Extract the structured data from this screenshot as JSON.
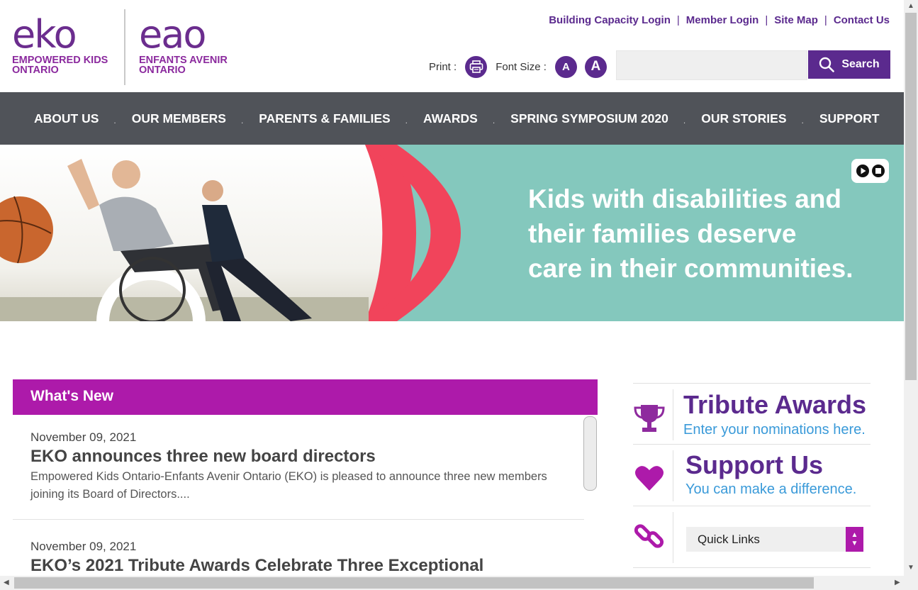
{
  "logos": {
    "eko": {
      "word": "eko",
      "line1": "EMPOWERED KIDS",
      "line2": "ONTARIO"
    },
    "eao": {
      "word": "eao",
      "line1": "ENFANTS AVENIR",
      "line2": "ONTARIO"
    }
  },
  "top_links": {
    "building_capacity": "Building Capacity Login",
    "member_login": "Member Login",
    "site_map": "Site Map",
    "contact_us": "Contact Us",
    "separator": "|"
  },
  "tools": {
    "print_label": "Print :",
    "font_size_label": "Font Size :",
    "font_small": "A",
    "font_large": "A"
  },
  "search": {
    "placeholder": "",
    "button_label": "Search"
  },
  "nav": {
    "items": [
      "ABOUT US",
      "OUR MEMBERS",
      "PARENTS & FAMILIES",
      "AWARDS",
      "SPRING SYMPOSIUM 2020",
      "OUR STORIES",
      "SUPPORT"
    ],
    "separator": "."
  },
  "banner": {
    "line1": "Kids with disabilities and",
    "line2": "their families deserve",
    "line3": "care in their communities."
  },
  "whats_new": {
    "heading": "What's New",
    "items": [
      {
        "date": "November 09, 2021",
        "title": "EKO announces three new board directors",
        "excerpt_line1": "Empowered Kids Ontario-Enfants Avenir Ontario (EKO) is pleased to announce three new members",
        "excerpt_line2": "joining its Board of Directors...."
      },
      {
        "date": "November 09, 2021",
        "title": "EKO’s 2021 Tribute Awards Celebrate Three Exceptional"
      }
    ]
  },
  "sidebar": {
    "tribute": {
      "title": "Tribute Awards",
      "subtitle": "Enter your nominations here.",
      "icon": "trophy-icon"
    },
    "support": {
      "title": "Support Us",
      "subtitle": "You can make a difference.",
      "icon": "heart-icon"
    },
    "quick_links": {
      "selected": "Quick Links",
      "icon": "link-icon"
    }
  },
  "colors": {
    "brand_purple": "#5b2a8e",
    "magenta": "#ad1aaa",
    "nav_gray": "#505359",
    "banner_teal": "#84c8bd",
    "banner_red": "#f1445b",
    "link_blue": "#3a9ad9"
  }
}
